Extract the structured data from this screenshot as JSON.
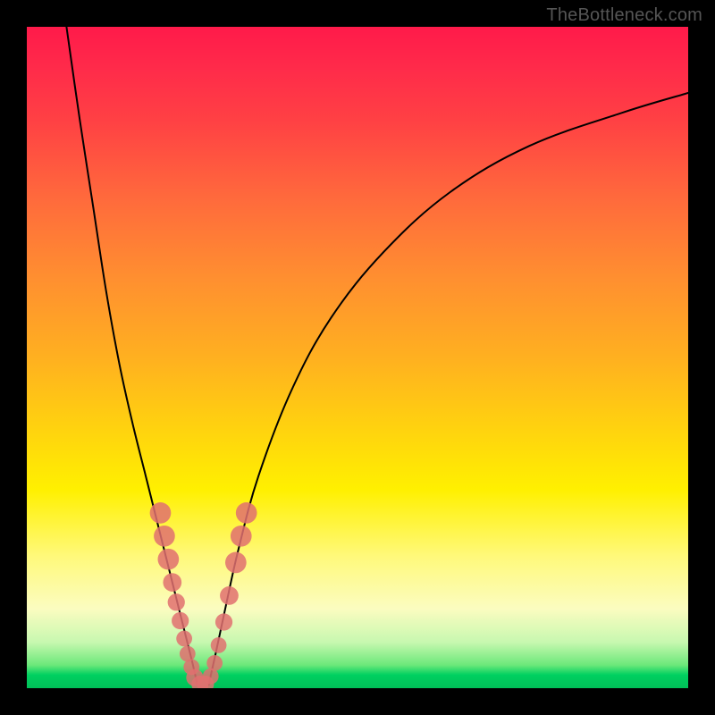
{
  "watermark": "TheBottleneck.com",
  "colors": {
    "frame": "#000000",
    "curve": "#000000",
    "marker": "#e07070",
    "gradient_top": "#ff1a4a",
    "gradient_bottom": "#00c058"
  },
  "chart_data": {
    "type": "line",
    "title": "",
    "xlabel": "",
    "ylabel": "",
    "xlim": [
      0,
      100
    ],
    "ylim": [
      0,
      100
    ],
    "annotations": [
      "TheBottleneck.com"
    ],
    "note": "No axis ticks, labels, or gridlines are shown; values are positional estimates mapping pixel space to 0-100.",
    "series": [
      {
        "name": "left-branch",
        "x": [
          6,
          8,
          10,
          12,
          14,
          16,
          18,
          20,
          21,
          22,
          23,
          24,
          25,
          25.8
        ],
        "y": [
          100,
          86,
          73,
          60,
          49,
          40,
          32,
          24,
          20,
          16,
          12,
          8,
          4,
          0.5
        ]
      },
      {
        "name": "right-branch",
        "x": [
          27.5,
          28.5,
          30,
          32,
          35,
          40,
          46,
          54,
          64,
          76,
          90,
          100
        ],
        "y": [
          0.5,
          5,
          12,
          21,
          32,
          45,
          56,
          66,
          75,
          82,
          87,
          90
        ]
      }
    ],
    "markers": {
      "name": "highlighted-points",
      "points": [
        {
          "x": 20.2,
          "y": 26.5,
          "r": 1.6
        },
        {
          "x": 20.8,
          "y": 23.0,
          "r": 1.6
        },
        {
          "x": 21.4,
          "y": 19.5,
          "r": 1.6
        },
        {
          "x": 22.0,
          "y": 16.0,
          "r": 1.4
        },
        {
          "x": 22.6,
          "y": 13.0,
          "r": 1.3
        },
        {
          "x": 23.2,
          "y": 10.2,
          "r": 1.3
        },
        {
          "x": 23.8,
          "y": 7.5,
          "r": 1.2
        },
        {
          "x": 24.3,
          "y": 5.2,
          "r": 1.2
        },
        {
          "x": 24.9,
          "y": 3.2,
          "r": 1.2
        },
        {
          "x": 25.4,
          "y": 1.6,
          "r": 1.3
        },
        {
          "x": 26.2,
          "y": 0.6,
          "r": 1.3
        },
        {
          "x": 27.0,
          "y": 0.6,
          "r": 1.3
        },
        {
          "x": 27.8,
          "y": 1.8,
          "r": 1.2
        },
        {
          "x": 28.4,
          "y": 3.8,
          "r": 1.2
        },
        {
          "x": 29.0,
          "y": 6.5,
          "r": 1.2
        },
        {
          "x": 29.8,
          "y": 10.0,
          "r": 1.3
        },
        {
          "x": 30.6,
          "y": 14.0,
          "r": 1.4
        },
        {
          "x": 31.6,
          "y": 19.0,
          "r": 1.6
        },
        {
          "x": 32.4,
          "y": 23.0,
          "r": 1.6
        },
        {
          "x": 33.2,
          "y": 26.5,
          "r": 1.6
        }
      ]
    }
  }
}
